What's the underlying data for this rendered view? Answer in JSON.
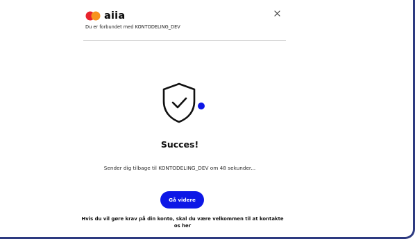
{
  "header": {
    "brand": "aiia",
    "connected_text": "Du er forbundet med KONTODELING_DEV",
    "logo_colors": {
      "left": "#e8232d",
      "right": "#f7931e"
    },
    "close_icon": "close-icon"
  },
  "main": {
    "icon": "shield-check-icon",
    "accent": "#0d17e6",
    "title": "Succes!",
    "message": "Sender dig tilbage til KONTODELING_DEV om 48 sekunder...",
    "cta_label": "Gå videre",
    "claim_text": "Hvis du vil gøre krav på din konto, skal du være velkommen til at kontakte os her"
  }
}
